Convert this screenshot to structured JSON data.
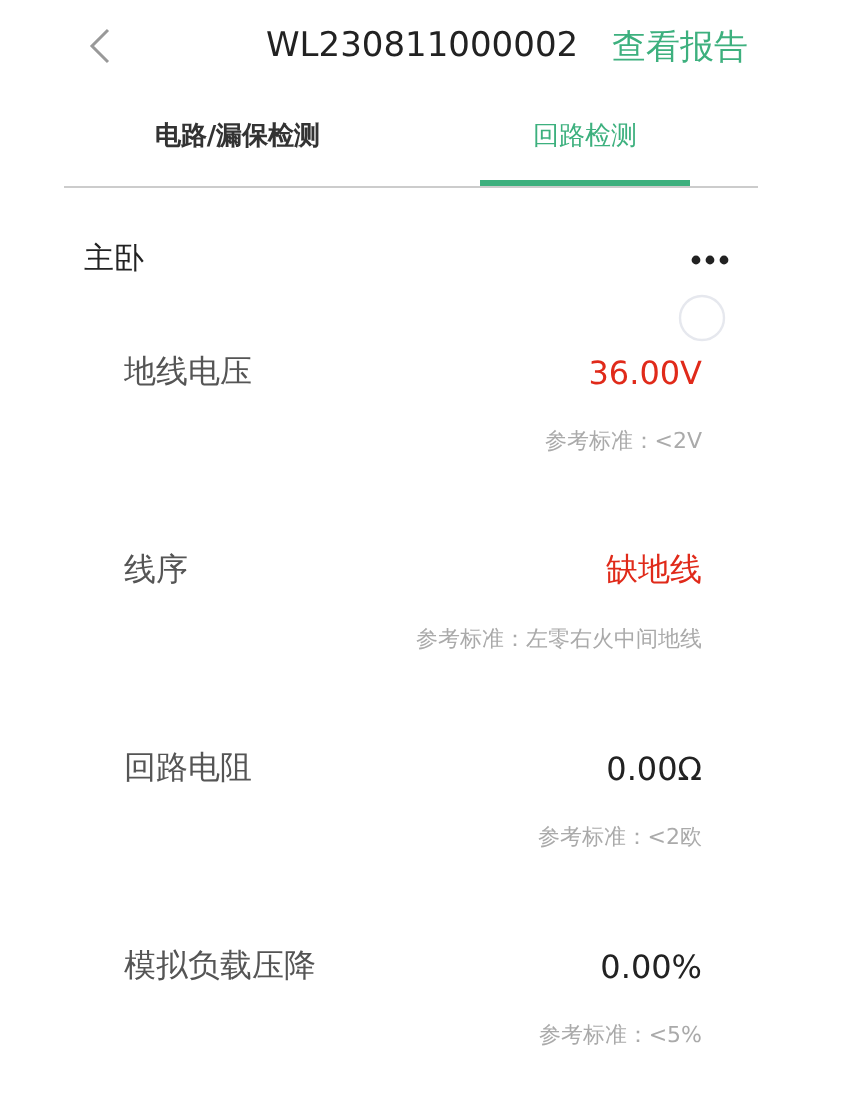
{
  "header": {
    "title": "WL230811000002",
    "action": "查看报告"
  },
  "tabs": [
    {
      "label": "电路/漏保检测",
      "selected": false
    },
    {
      "label": "回路检测",
      "selected": true
    }
  ],
  "section": {
    "title": "主卧"
  },
  "measurements": [
    {
      "name": "地线电压",
      "value": "36.00V",
      "abnormal": true,
      "standard": "参考标准：<2V"
    },
    {
      "name": "线序",
      "value": "缺地线",
      "abnormal": true,
      "standard": "参考标准：左零右火中间地线"
    },
    {
      "name": "回路电阻",
      "value": "0.00Ω",
      "abnormal": false,
      "standard": "参考标准：<2欧"
    },
    {
      "name": "模拟负载压降",
      "value": "0.00%",
      "abnormal": false,
      "standard": "参考标准：<5%"
    }
  ]
}
